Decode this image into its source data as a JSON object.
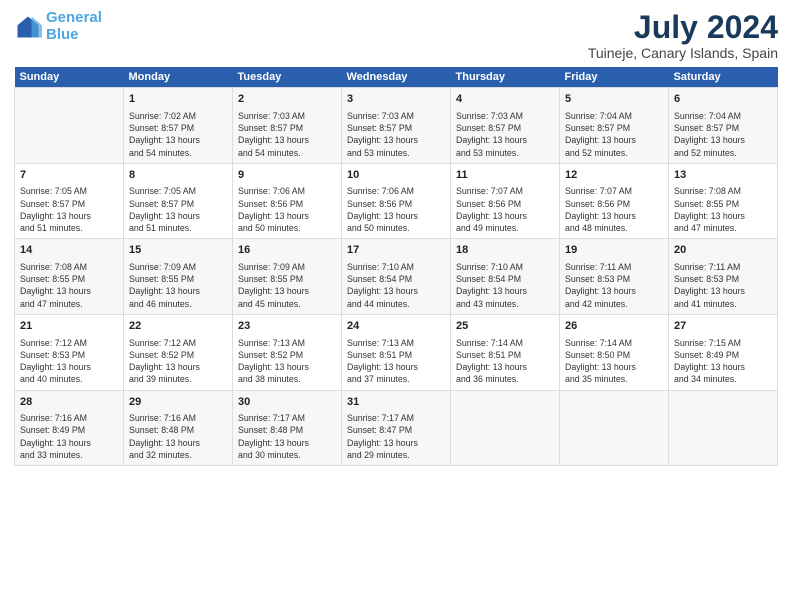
{
  "logo": {
    "line1": "General",
    "line2": "Blue"
  },
  "title": "July 2024",
  "subtitle": "Tuineje, Canary Islands, Spain",
  "columns": [
    "Sunday",
    "Monday",
    "Tuesday",
    "Wednesday",
    "Thursday",
    "Friday",
    "Saturday"
  ],
  "weeks": [
    {
      "days": [
        {
          "num": "",
          "lines": []
        },
        {
          "num": "1",
          "lines": [
            "Sunrise: 7:02 AM",
            "Sunset: 8:57 PM",
            "Daylight: 13 hours",
            "and 54 minutes."
          ]
        },
        {
          "num": "2",
          "lines": [
            "Sunrise: 7:03 AM",
            "Sunset: 8:57 PM",
            "Daylight: 13 hours",
            "and 54 minutes."
          ]
        },
        {
          "num": "3",
          "lines": [
            "Sunrise: 7:03 AM",
            "Sunset: 8:57 PM",
            "Daylight: 13 hours",
            "and 53 minutes."
          ]
        },
        {
          "num": "4",
          "lines": [
            "Sunrise: 7:03 AM",
            "Sunset: 8:57 PM",
            "Daylight: 13 hours",
            "and 53 minutes."
          ]
        },
        {
          "num": "5",
          "lines": [
            "Sunrise: 7:04 AM",
            "Sunset: 8:57 PM",
            "Daylight: 13 hours",
            "and 52 minutes."
          ]
        },
        {
          "num": "6",
          "lines": [
            "Sunrise: 7:04 AM",
            "Sunset: 8:57 PM",
            "Daylight: 13 hours",
            "and 52 minutes."
          ]
        }
      ]
    },
    {
      "days": [
        {
          "num": "7",
          "lines": [
            "Sunrise: 7:05 AM",
            "Sunset: 8:57 PM",
            "Daylight: 13 hours",
            "and 51 minutes."
          ]
        },
        {
          "num": "8",
          "lines": [
            "Sunrise: 7:05 AM",
            "Sunset: 8:57 PM",
            "Daylight: 13 hours",
            "and 51 minutes."
          ]
        },
        {
          "num": "9",
          "lines": [
            "Sunrise: 7:06 AM",
            "Sunset: 8:56 PM",
            "Daylight: 13 hours",
            "and 50 minutes."
          ]
        },
        {
          "num": "10",
          "lines": [
            "Sunrise: 7:06 AM",
            "Sunset: 8:56 PM",
            "Daylight: 13 hours",
            "and 50 minutes."
          ]
        },
        {
          "num": "11",
          "lines": [
            "Sunrise: 7:07 AM",
            "Sunset: 8:56 PM",
            "Daylight: 13 hours",
            "and 49 minutes."
          ]
        },
        {
          "num": "12",
          "lines": [
            "Sunrise: 7:07 AM",
            "Sunset: 8:56 PM",
            "Daylight: 13 hours",
            "and 48 minutes."
          ]
        },
        {
          "num": "13",
          "lines": [
            "Sunrise: 7:08 AM",
            "Sunset: 8:55 PM",
            "Daylight: 13 hours",
            "and 47 minutes."
          ]
        }
      ]
    },
    {
      "days": [
        {
          "num": "14",
          "lines": [
            "Sunrise: 7:08 AM",
            "Sunset: 8:55 PM",
            "Daylight: 13 hours",
            "and 47 minutes."
          ]
        },
        {
          "num": "15",
          "lines": [
            "Sunrise: 7:09 AM",
            "Sunset: 8:55 PM",
            "Daylight: 13 hours",
            "and 46 minutes."
          ]
        },
        {
          "num": "16",
          "lines": [
            "Sunrise: 7:09 AM",
            "Sunset: 8:55 PM",
            "Daylight: 13 hours",
            "and 45 minutes."
          ]
        },
        {
          "num": "17",
          "lines": [
            "Sunrise: 7:10 AM",
            "Sunset: 8:54 PM",
            "Daylight: 13 hours",
            "and 44 minutes."
          ]
        },
        {
          "num": "18",
          "lines": [
            "Sunrise: 7:10 AM",
            "Sunset: 8:54 PM",
            "Daylight: 13 hours",
            "and 43 minutes."
          ]
        },
        {
          "num": "19",
          "lines": [
            "Sunrise: 7:11 AM",
            "Sunset: 8:53 PM",
            "Daylight: 13 hours",
            "and 42 minutes."
          ]
        },
        {
          "num": "20",
          "lines": [
            "Sunrise: 7:11 AM",
            "Sunset: 8:53 PM",
            "Daylight: 13 hours",
            "and 41 minutes."
          ]
        }
      ]
    },
    {
      "days": [
        {
          "num": "21",
          "lines": [
            "Sunrise: 7:12 AM",
            "Sunset: 8:53 PM",
            "Daylight: 13 hours",
            "and 40 minutes."
          ]
        },
        {
          "num": "22",
          "lines": [
            "Sunrise: 7:12 AM",
            "Sunset: 8:52 PM",
            "Daylight: 13 hours",
            "and 39 minutes."
          ]
        },
        {
          "num": "23",
          "lines": [
            "Sunrise: 7:13 AM",
            "Sunset: 8:52 PM",
            "Daylight: 13 hours",
            "and 38 minutes."
          ]
        },
        {
          "num": "24",
          "lines": [
            "Sunrise: 7:13 AM",
            "Sunset: 8:51 PM",
            "Daylight: 13 hours",
            "and 37 minutes."
          ]
        },
        {
          "num": "25",
          "lines": [
            "Sunrise: 7:14 AM",
            "Sunset: 8:51 PM",
            "Daylight: 13 hours",
            "and 36 minutes."
          ]
        },
        {
          "num": "26",
          "lines": [
            "Sunrise: 7:14 AM",
            "Sunset: 8:50 PM",
            "Daylight: 13 hours",
            "and 35 minutes."
          ]
        },
        {
          "num": "27",
          "lines": [
            "Sunrise: 7:15 AM",
            "Sunset: 8:49 PM",
            "Daylight: 13 hours",
            "and 34 minutes."
          ]
        }
      ]
    },
    {
      "days": [
        {
          "num": "28",
          "lines": [
            "Sunrise: 7:16 AM",
            "Sunset: 8:49 PM",
            "Daylight: 13 hours",
            "and 33 minutes."
          ]
        },
        {
          "num": "29",
          "lines": [
            "Sunrise: 7:16 AM",
            "Sunset: 8:48 PM",
            "Daylight: 13 hours",
            "and 32 minutes."
          ]
        },
        {
          "num": "30",
          "lines": [
            "Sunrise: 7:17 AM",
            "Sunset: 8:48 PM",
            "Daylight: 13 hours",
            "and 30 minutes."
          ]
        },
        {
          "num": "31",
          "lines": [
            "Sunrise: 7:17 AM",
            "Sunset: 8:47 PM",
            "Daylight: 13 hours",
            "and 29 minutes."
          ]
        },
        {
          "num": "",
          "lines": []
        },
        {
          "num": "",
          "lines": []
        },
        {
          "num": "",
          "lines": []
        }
      ]
    }
  ]
}
